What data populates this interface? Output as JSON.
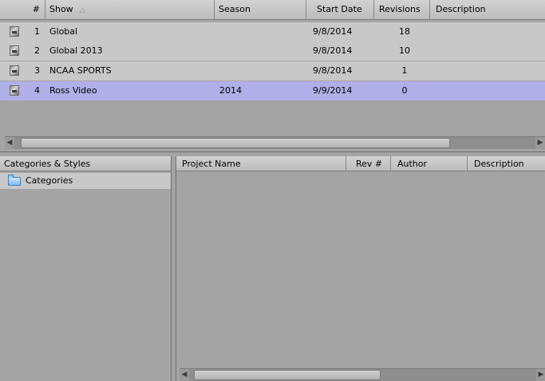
{
  "shows_grid": {
    "columns": [
      {
        "label": "#"
      },
      {
        "label": "Show",
        "sort_indicator": "△"
      },
      {
        "label": "Season"
      },
      {
        "label": "Start Date"
      },
      {
        "label": "Revisions"
      },
      {
        "label": "Description"
      }
    ],
    "rows": [
      {
        "num": "1",
        "show": "Global",
        "season": "",
        "start_date": "9/8/2014",
        "revisions": "18",
        "description": ""
      },
      {
        "num": "2",
        "show": "Global 2013",
        "season": "",
        "start_date": "9/8/2014",
        "revisions": "10",
        "description": ""
      },
      {
        "num": "3",
        "show": "NCAA SPORTS",
        "season": "",
        "start_date": "9/8/2014",
        "revisions": "1",
        "description": ""
      },
      {
        "num": "4",
        "show": "Ross Video",
        "season": "2014",
        "start_date": "9/9/2014",
        "revisions": "0",
        "description": ""
      }
    ],
    "selected_row": 4,
    "scroll_arrows": {
      "left": "◀",
      "right": "▶"
    }
  },
  "categories_panel": {
    "header": "Categories & Styles",
    "items": [
      {
        "label": "Categories",
        "icon": "folder-icon"
      }
    ]
  },
  "projects_panel": {
    "columns": [
      {
        "label": "Project Name"
      },
      {
        "label": "Rev #"
      },
      {
        "label": "Author"
      },
      {
        "label": "Description"
      }
    ],
    "scroll_arrows": {
      "left": "◀",
      "right": "▶"
    }
  },
  "colors": {
    "background": "#a4a4a4",
    "row": "#c8c8c8",
    "selected_row": "#b0afe7",
    "header": "#c6c6c6"
  }
}
